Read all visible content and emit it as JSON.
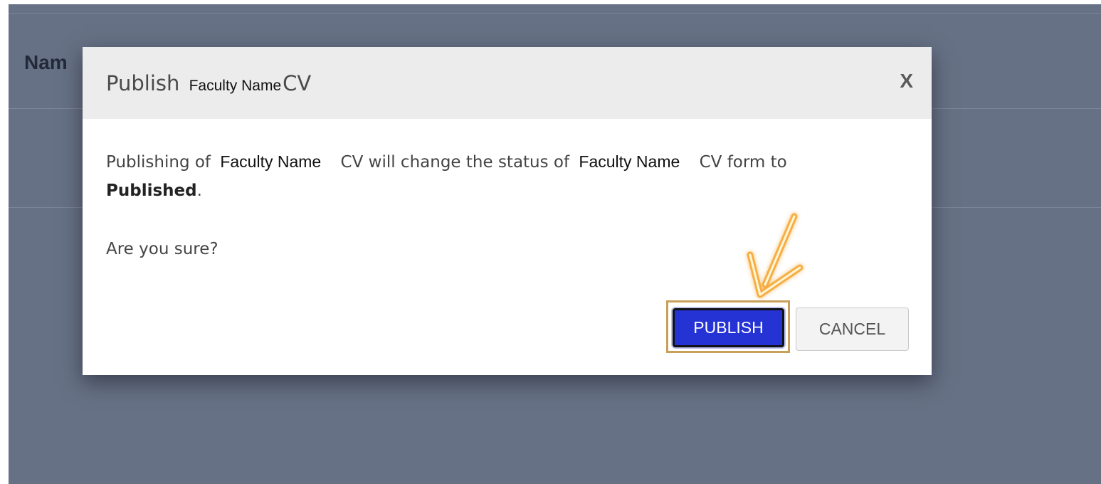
{
  "background": {
    "heading": "Nam"
  },
  "dialog": {
    "title_prefix": "Publish",
    "title_name": "Faculty Name",
    "title_suffix": "CV",
    "close_label": "X",
    "body": {
      "part1": "Publishing of",
      "name1": "Faculty Name",
      "part2": "CV will change the status of",
      "name2": "Faculty Name",
      "part3": "CV form to",
      "status": "Published",
      "period": "."
    },
    "confirm_question": "Are you sure?",
    "buttons": {
      "publish_label": "PUBLISH",
      "cancel_label": "CANCEL"
    }
  },
  "colors": {
    "backdrop": "#677185",
    "header": "#ececec",
    "publish_button": "#2633d4",
    "highlight_frame": "#c8a05a",
    "annotation_arrow": "#f5a623"
  },
  "icons": {
    "annotation": "arrow-pointer-icon"
  }
}
